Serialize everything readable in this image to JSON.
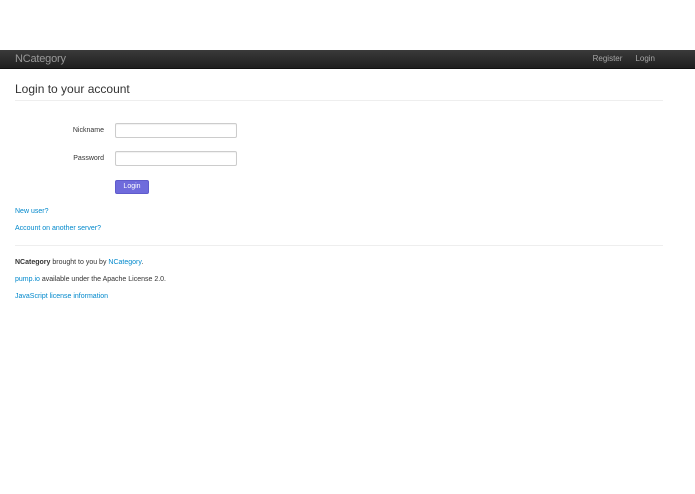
{
  "navbar": {
    "brand": "NCategory",
    "register": "Register",
    "login": "Login"
  },
  "main": {
    "title": "Login to your account",
    "form": {
      "nickname_label": "Nickname",
      "nickname_value": "",
      "password_label": "Password",
      "password_value": "",
      "submit_label": "Login"
    },
    "links": {
      "new_user": "New user?",
      "other_server": "Account on another server?"
    }
  },
  "footer": {
    "line1_brand": "NCategory",
    "line1_text": " brought to you by ",
    "line1_link": "NCategory",
    "line1_end": ".",
    "line2_link": "pump.io",
    "line2_text": " available under the Apache License 2.0.",
    "line3_link": "JavaScript license information"
  },
  "colors": {
    "navbar": "#222222",
    "link": "#0088cc",
    "primary_button": "#6f6bdc"
  }
}
